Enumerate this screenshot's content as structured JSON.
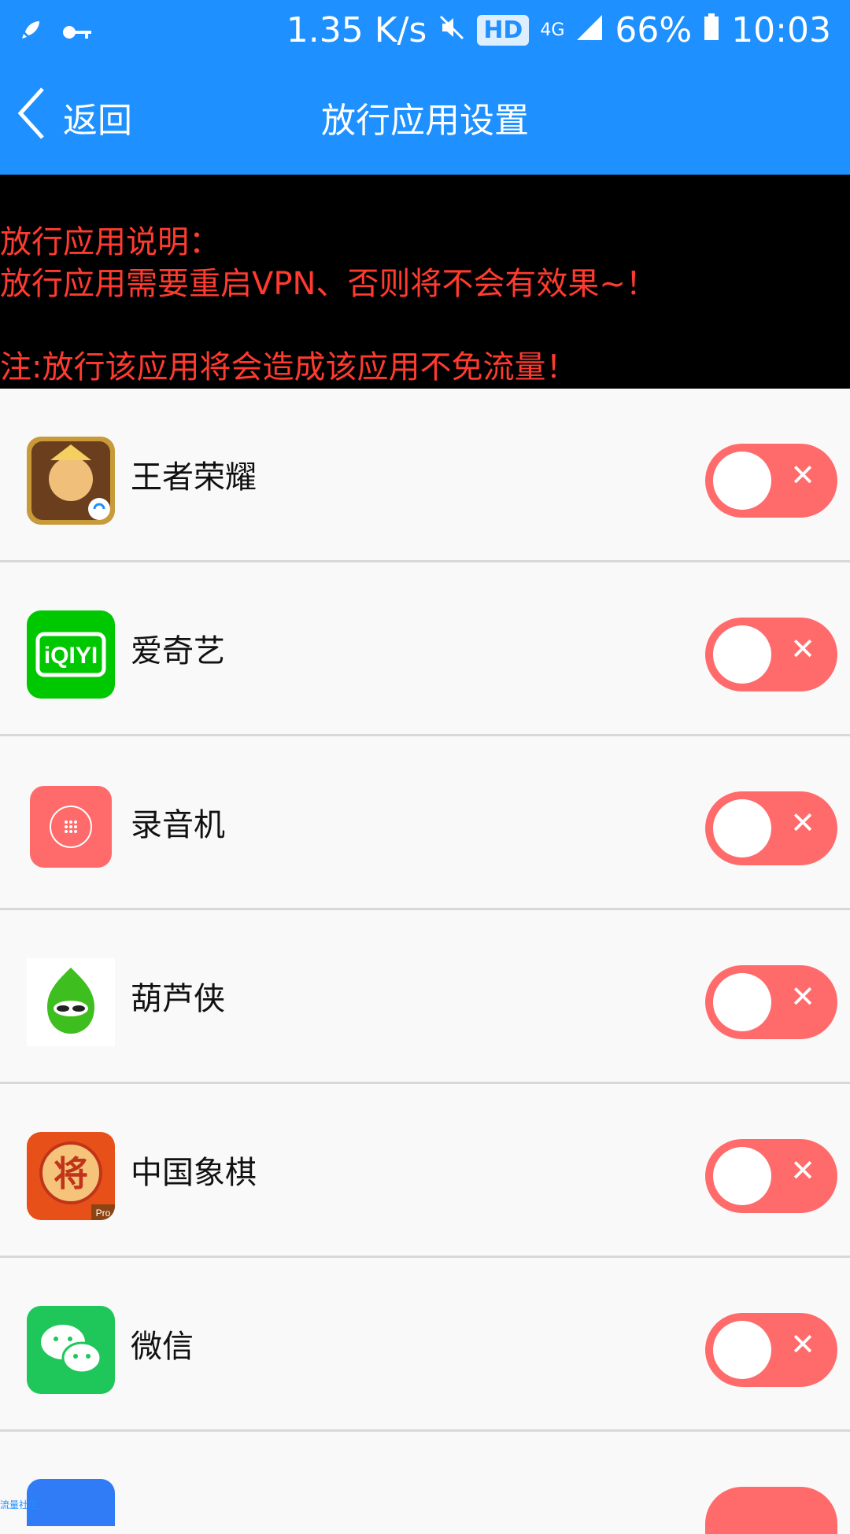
{
  "status_bar": {
    "speed": "1.35 K/s",
    "hd": "HD",
    "network": "4G",
    "battery": "66%",
    "time": "10:03",
    "icons": [
      "rocket-icon",
      "key-icon",
      "mute-icon",
      "signal-icon",
      "battery-icon"
    ]
  },
  "header": {
    "back_label": "返回",
    "title": "放行应用设置"
  },
  "notice": {
    "line1": "放行应用说明：",
    "line2": "放行应用需要重启VPN、否则将不会有效果~！",
    "line3": "注:放行该应用将会造成该应用不免流量！"
  },
  "apps": [
    {
      "name": "王者荣耀",
      "toggle_state": "off",
      "icon": "honor-of-kings-icon"
    },
    {
      "name": "爱奇艺",
      "toggle_state": "off",
      "icon": "iqiyi-icon"
    },
    {
      "name": "录音机",
      "toggle_state": "off",
      "icon": "recorder-icon"
    },
    {
      "name": "葫芦侠",
      "toggle_state": "off",
      "icon": "huluxia-icon"
    },
    {
      "name": "中国象棋",
      "toggle_state": "off",
      "icon": "chinese-chess-icon"
    },
    {
      "name": "微信",
      "toggle_state": "off",
      "icon": "wechat-icon"
    }
  ],
  "iqiyi_logo_text": "iQIYI",
  "chess_logo_text": "将",
  "chess_pro_text": "Pro",
  "watermark": "流量社区",
  "colors": {
    "primary": "#1e90ff",
    "notice_bg": "#000000",
    "notice_text": "#ff3b30",
    "toggle_off": "#ff6b6b"
  }
}
